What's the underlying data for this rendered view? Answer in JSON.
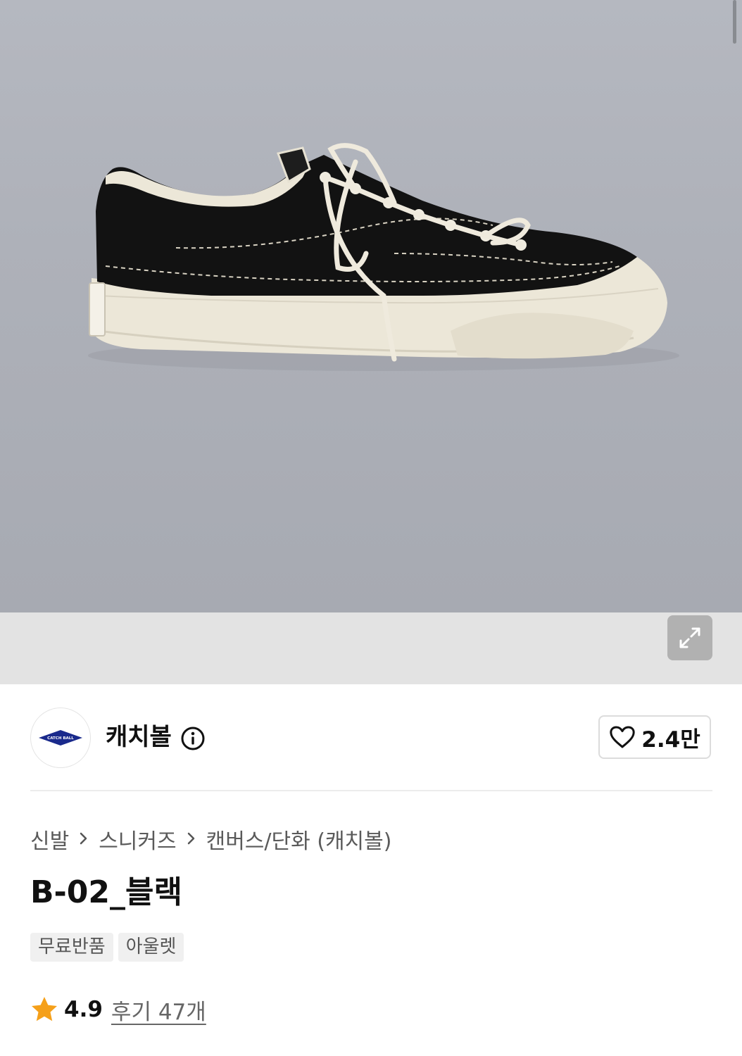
{
  "product_image": {
    "alt": "black canvas low-top sneaker with cream sole",
    "icons": {
      "expand": "expand-icon"
    }
  },
  "brand": {
    "logo_text": "CATCH BALL",
    "name": "캐치볼",
    "info_icon": "info-icon",
    "like_icon": "heart-icon",
    "like_count": "2.4만"
  },
  "breadcrumb": {
    "items": [
      "신발",
      "스니커즈",
      "캔버스/단화 (캐치볼)"
    ],
    "separator_icon": "chevron-right-icon"
  },
  "product": {
    "title": "B-02_블랙",
    "tags": [
      "무료반품",
      "아울렛"
    ]
  },
  "rating": {
    "star_icon": "star-icon",
    "value": "4.9",
    "reviews_label": "후기 47개"
  },
  "colors": {
    "star": "#f5a01a",
    "brand_logo": "#1a2a8c",
    "hero_bg": "#aeb1b9"
  }
}
